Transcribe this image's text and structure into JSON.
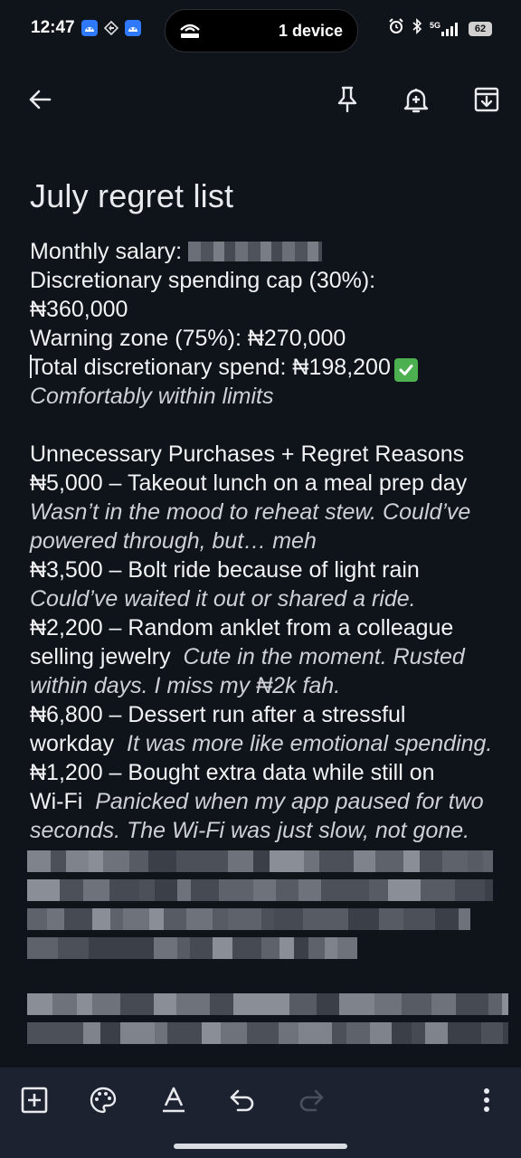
{
  "status_bar": {
    "time": "12:47",
    "island_text": "1 device",
    "network": "5G",
    "battery": "62"
  },
  "toolbar": {
    "back_icon": "arrow-left-icon",
    "pin_icon": "pin-icon",
    "reminder_icon": "bell-plus-icon",
    "archive_icon": "archive-icon"
  },
  "note": {
    "title": "July regret list",
    "summary": {
      "salary_label": "Monthly salary:",
      "cap_line": "Discretionary spending cap (30%):",
      "cap_value": "₦360,000",
      "warning_line": "Warning zone (75%): ₦270,000",
      "total_line": "Total discretionary spend: ₦198,200",
      "status_note": "Comfortably within limits"
    },
    "section_heading": "Unnecessary Purchases + Regret Reasons",
    "items": [
      {
        "line1": "₦5,000 – Takeout lunch on a meal prep day",
        "reason1": "Wasn’t in the mood to reheat stew. Could’ve",
        "reason2": "powered through, but… meh"
      },
      {
        "line1": "₦3,500 – Bolt ride because of light rain",
        "reason1": "Could’ve waited it out or shared a ride."
      },
      {
        "line1": "₦2,200 – Random anklet from a colleague",
        "line2": "selling jewelry",
        "reason_inline": "Cute in the moment. Rusted",
        "reason2": "within days. I miss my ₦2k fah."
      },
      {
        "line1": "₦6,800 – Dessert run after a stressful",
        "line2": "workday",
        "reason_inline": "It was more like emotional spending."
      },
      {
        "line1": "₦1,200 – Bought extra data while still on",
        "line2": "Wi-Fi",
        "reason_inline": "Panicked when my app paused for two",
        "reason2": "seconds. The Wi-Fi was just slow, not gone."
      }
    ]
  },
  "bottom_bar": {
    "add_icon": "add-box-icon",
    "palette_icon": "palette-icon",
    "text_format_icon": "text-format-icon",
    "undo_icon": "undo-icon",
    "redo_icon": "redo-icon",
    "more_icon": "more-vert-icon"
  },
  "colors": {
    "background": "#0f131a",
    "bottom_bar": "#1c2230",
    "text": "#f1f3f4",
    "check": "#4caf50"
  }
}
